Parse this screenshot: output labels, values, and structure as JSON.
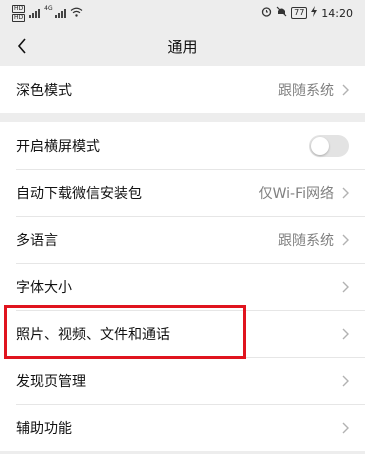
{
  "status_bar": {
    "time": "14:20",
    "battery": "77",
    "network_tags": [
      "4G"
    ],
    "sim_tags": [
      "HD",
      "HD"
    ],
    "icons": [
      "alarm-icon",
      "mute-icon",
      "battery-icon",
      "charging-icon",
      "wifi-icon",
      "signal-icon"
    ]
  },
  "header": {
    "title": "通用",
    "back_icon": "chevron-left-icon"
  },
  "settings": {
    "dark_mode": {
      "label": "深色模式",
      "value": "跟随系统"
    },
    "landscape": {
      "label": "开启横屏模式",
      "enabled": false
    },
    "auto_download": {
      "label": "自动下载微信安装包",
      "value": "仅Wi-Fi网络"
    },
    "language": {
      "label": "多语言",
      "value": "跟随系统"
    },
    "font_size": {
      "label": "字体大小"
    },
    "media": {
      "label": "照片、视频、文件和通话",
      "highlighted": true
    },
    "discover": {
      "label": "发现页管理"
    },
    "accessibility": {
      "label": "辅助功能"
    }
  },
  "colors": {
    "background": "#ededed",
    "row_background": "#ffffff",
    "highlight": "#e0141e",
    "secondary_text": "#808080",
    "toggle_off": "#e3e3e3"
  }
}
